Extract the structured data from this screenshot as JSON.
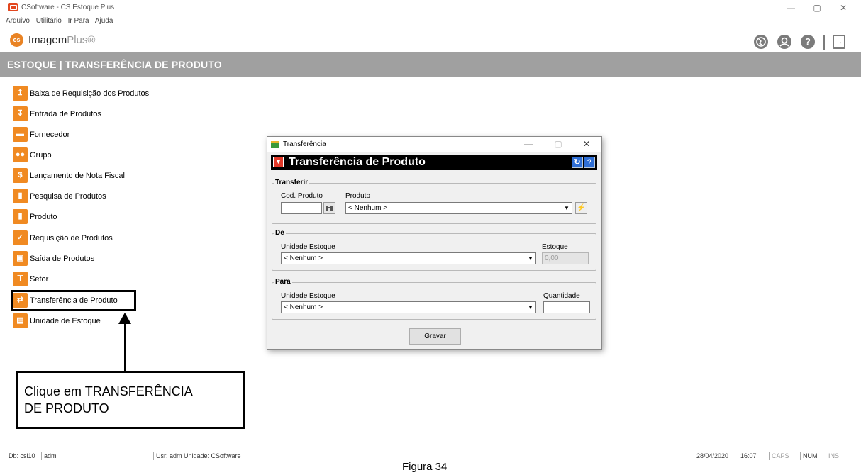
{
  "window": {
    "title": "CSoftware - CS Estoque Plus",
    "controls": {
      "minimize": "—",
      "maximize": "▢",
      "close": "✕"
    }
  },
  "menu": [
    "Arquivo",
    "Utilitário",
    "Ir Para",
    "Ajuda"
  ],
  "brand": {
    "logo": "cs",
    "name": "Imagem",
    "suffix": "Plus®",
    "accent": "#e98324"
  },
  "header_icons": [
    "globe-icon",
    "user-icon",
    "help-icon",
    "exit-icon"
  ],
  "section_title": "ESTOQUE | TRANSFERÊNCIA DE PRODUTO",
  "side_menu": [
    {
      "label": "Baixa de Requisição dos Produtos",
      "icon": "box-out-icon"
    },
    {
      "label": "Entrada de Produtos",
      "icon": "box-in-icon"
    },
    {
      "label": "Fornecedor",
      "icon": "truck-icon"
    },
    {
      "label": "Grupo",
      "icon": "group-icon"
    },
    {
      "label": "Lançamento de Nota Fiscal",
      "icon": "money-icon"
    },
    {
      "label": "Pesquisa de Produtos",
      "icon": "cylinder-icon"
    },
    {
      "label": "Produto",
      "icon": "cylinder-icon"
    },
    {
      "label": "Requisição de Produtos",
      "icon": "check-icon"
    },
    {
      "label": "Saída de Produtos",
      "icon": "exit-box-icon"
    },
    {
      "label": "Setor",
      "icon": "org-chart-icon"
    },
    {
      "label": "Transferência de Produto",
      "icon": "transfer-icon"
    },
    {
      "label": "Unidade de Estoque",
      "icon": "storage-icon"
    }
  ],
  "callout": {
    "line1": "Clique em TRANSFERÊNCIA",
    "line2": "DE PRODUTO"
  },
  "dialog": {
    "window_title": "Transferência",
    "header_title": "Transferência de Produto",
    "transferir": {
      "legend": "Transferir",
      "cod_label": "Cod. Produto",
      "cod_value": "",
      "produto_label": "Produto",
      "produto_value": "< Nenhum >"
    },
    "de": {
      "legend": "De",
      "unidade_label": "Unidade Estoque",
      "unidade_value": "< Nenhum >",
      "estoque_label": "Estoque",
      "estoque_value": "0,00"
    },
    "para": {
      "legend": "Para",
      "unidade_label": "Unidade Estoque",
      "unidade_value": "< Nenhum >",
      "quantidade_label": "Quantidade",
      "quantidade_value": ""
    },
    "gravar_label": "Gravar"
  },
  "statusbar": {
    "db": "Db: csi10",
    "user": "adm",
    "usr_unidade": "Usr: adm  Unidade: CSoftware",
    "date": "28/04/2020",
    "time": "16:07",
    "caps": "CAPS",
    "num": "NUM",
    "ins": "INS"
  },
  "caption": "Figura 34"
}
